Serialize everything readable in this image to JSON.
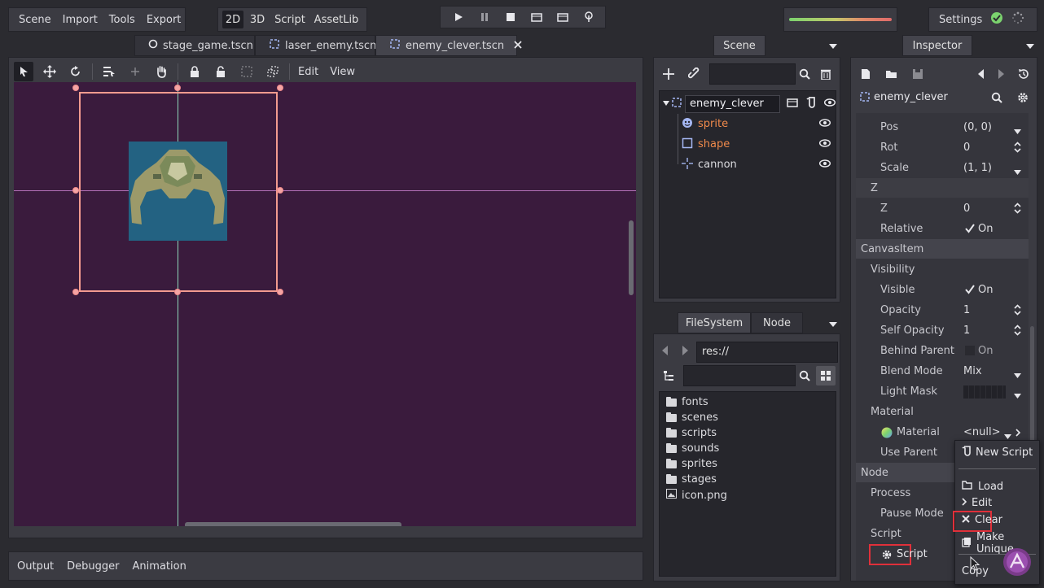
{
  "menu": {
    "scene": "Scene",
    "import": "Import",
    "tools": "Tools",
    "export": "Export"
  },
  "modes": {
    "d2": "2D",
    "d3": "3D",
    "script": "Script",
    "assetlib": "AssetLib"
  },
  "settings_label": "Settings",
  "scene_tabs": [
    {
      "label": "stage_game.tscn"
    },
    {
      "label": "laser_enemy.tscn"
    },
    {
      "label": "enemy_clever.tscn"
    }
  ],
  "viewport_menu": {
    "edit": "Edit",
    "view": "View"
  },
  "scene_dock": {
    "tab": "Scene",
    "root": "enemy_clever",
    "children": [
      {
        "label": "sprite",
        "color": "#f08a4b"
      },
      {
        "label": "shape",
        "color": "#f08a4b"
      },
      {
        "label": "cannon",
        "color": "#dcdce0"
      }
    ]
  },
  "filesystem": {
    "tab_fs": "FileSystem",
    "tab_node": "Node",
    "path": "res://",
    "items": [
      {
        "label": "fonts"
      },
      {
        "label": "scenes"
      },
      {
        "label": "scripts"
      },
      {
        "label": "sounds"
      },
      {
        "label": "sprites"
      },
      {
        "label": "stages"
      },
      {
        "label": "icon.png"
      }
    ]
  },
  "inspector": {
    "tab": "Inspector",
    "node_name": "enemy_clever",
    "props": {
      "pos_label": "Pos",
      "pos_value": "(0, 0)",
      "rot_label": "Rot",
      "rot_value": "0",
      "scale_label": "Scale",
      "scale_value": "(1, 1)",
      "z_section": "Z",
      "z_label": "Z",
      "z_value": "0",
      "relative_label": "Relative",
      "relative_value": "On",
      "canvasitem_section": "CanvasItem",
      "visibility_section": "Visibility",
      "visible_label": "Visible",
      "visible_value": "On",
      "opacity_label": "Opacity",
      "opacity_value": "1",
      "selfopacity_label": "Self Opacity",
      "selfopacity_value": "1",
      "behind_label": "Behind Parent",
      "behind_value": "On",
      "blend_label": "Blend Mode",
      "blend_value": "Mix",
      "lightmask_label": "Light Mask",
      "material_section": "Material",
      "material_label": "Material",
      "material_value": "<null>",
      "useparent_label": "Use Parent",
      "node_section": "Node",
      "process_label": "Process",
      "pause_label": "Pause Mode",
      "script_section": "Script",
      "script_button": "Script"
    }
  },
  "context_menu": {
    "new_script": "New Script",
    "load": "Load",
    "edit": "Edit",
    "clear": "Clear",
    "make_unique": "Make Unique",
    "copy": "Copy"
  },
  "bottom": {
    "output": "Output",
    "debugger": "Debugger",
    "animation": "Animation"
  },
  "colors": {
    "viewport_bg": "#3a1b3d",
    "selection": "#f29b8f",
    "highlight": "#e0303a",
    "accent": "#4d9be0"
  }
}
